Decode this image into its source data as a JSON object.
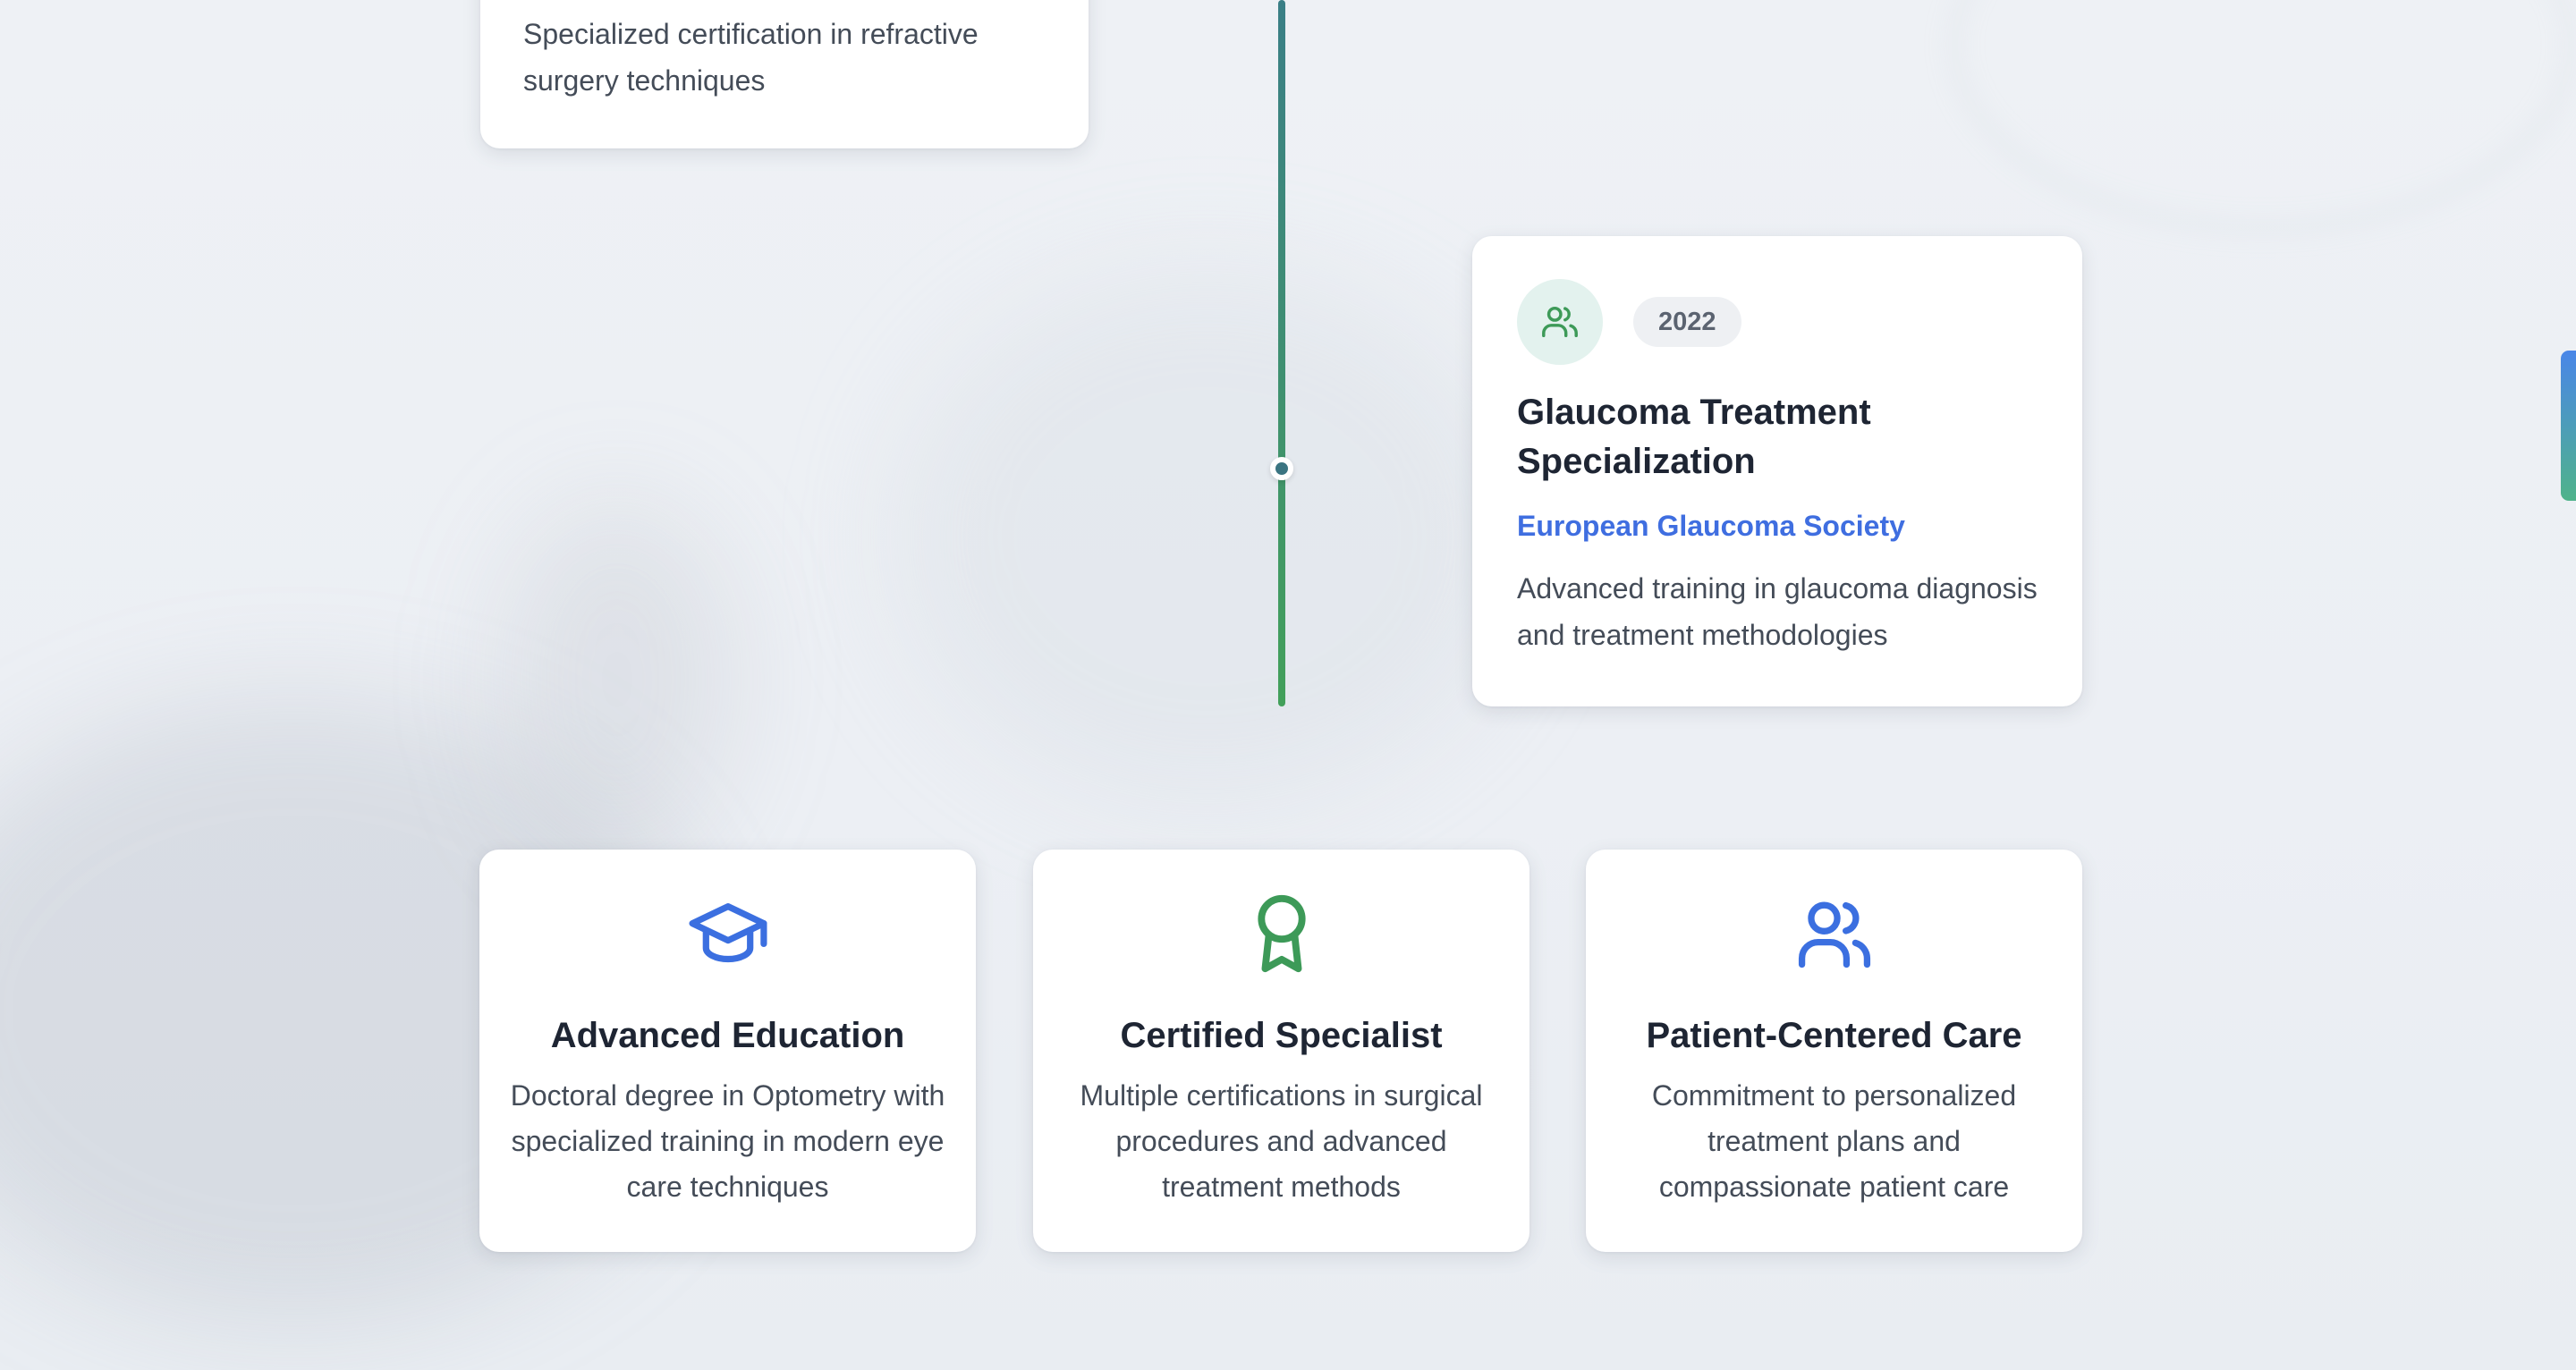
{
  "timeline": {
    "previous_card": {
      "description": "Specialized certification in refractive surgery techniques"
    },
    "card_2022": {
      "icon": "users-icon",
      "year": "2022",
      "title": "Glaucoma Treatment Specialization",
      "organization": "European Glaucoma Society",
      "description": "Advanced training in glaucoma diagnosis and treatment methodologies"
    }
  },
  "features": [
    {
      "icon": "graduation-cap-icon",
      "title": "Advanced Education",
      "description": "Doctoral degree in Optometry with specialized training in modern eye care techniques"
    },
    {
      "icon": "award-icon",
      "title": "Certified Specialist",
      "description": "Multiple certifications in surgical procedures and advanced treatment methods"
    },
    {
      "icon": "users-icon",
      "title": "Patient-Centered Care",
      "description": "Commitment to personalized treatment plans and compassionate patient care"
    }
  ],
  "colors": {
    "accent_blue": "#3f6ee0",
    "accent_green": "#42a05a",
    "timeline_teal": "#3a7f86"
  }
}
